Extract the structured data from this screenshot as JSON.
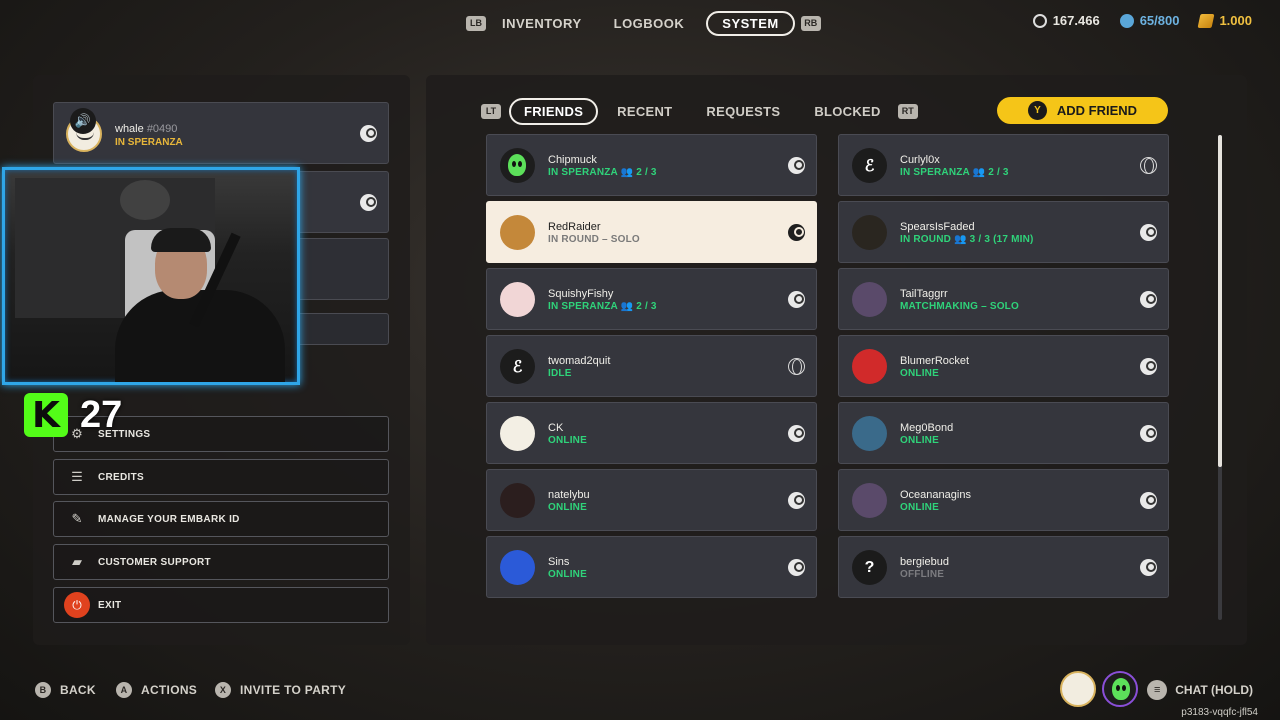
{
  "top_nav": {
    "left_bumper": "LB",
    "right_bumper": "RB",
    "tabs": [
      "INVENTORY",
      "LOGBOOK",
      "SYSTEM"
    ],
    "active_tab": "SYSTEM"
  },
  "currency": {
    "credits": "167.466",
    "storage": "65/800",
    "multibucks": "1.000"
  },
  "party": {
    "member_1": {
      "name": "whale",
      "tag": "#0490",
      "status": "IN SPERANZA"
    }
  },
  "menu": {
    "settings": "SETTINGS",
    "credits": "CREDITS",
    "manage_embark_id": "MANAGE YOUR EMBARK ID",
    "customer_support": "CUSTOMER SUPPORT",
    "exit": "EXIT"
  },
  "stream_overlay": {
    "platform_logo": "K",
    "viewer_count": "27"
  },
  "friends": {
    "left_trigger": "LT",
    "right_trigger": "RT",
    "tabs": [
      "FRIENDS",
      "RECENT",
      "REQUESTS",
      "BLOCKED"
    ],
    "active_tab": "FRIENDS",
    "add_friend_button": "ADD FRIEND",
    "add_friend_key": "Y",
    "list": [
      {
        "name": "Chipmuck",
        "status": "IN SPERANZA",
        "extra": "2 / 3",
        "platform": "steam",
        "avatar": "alien"
      },
      {
        "name": "Curlyl0x",
        "status": "IN SPERANZA",
        "extra": "2 / 3",
        "platform": "web",
        "avatar": "embark"
      },
      {
        "name": "RedRaider",
        "status": "IN ROUND – SOLO",
        "extra": "",
        "platform": "steam",
        "avatar": "photo"
      },
      {
        "name": "SpearsIsFaded",
        "status": "IN ROUND",
        "extra": "3 / 3 (17 MIN)",
        "platform": "steam",
        "avatar": "text"
      },
      {
        "name": "SquishyFishy",
        "status": "IN SPERANZA",
        "extra": "2 / 3",
        "platform": "steam",
        "avatar": "cartoon"
      },
      {
        "name": "TailTaggrr",
        "status": "MATCHMAKING – SOLO",
        "extra": "",
        "platform": "steam",
        "avatar": "art"
      },
      {
        "name": "twomad2quit",
        "status": "IDLE",
        "extra": "",
        "platform": "web",
        "avatar": "embark"
      },
      {
        "name": "BlumerRocket",
        "status": "ONLINE",
        "extra": "",
        "platform": "steam",
        "avatar": "red"
      },
      {
        "name": "CK",
        "status": "ONLINE",
        "extra": "",
        "platform": "steam",
        "avatar": "face"
      },
      {
        "name": "Meg0Bond",
        "status": "ONLINE",
        "extra": "",
        "platform": "steam",
        "avatar": "eye"
      },
      {
        "name": "natelybu",
        "status": "ONLINE",
        "extra": "",
        "platform": "steam",
        "avatar": "dark"
      },
      {
        "name": "Oceananagins",
        "status": "ONLINE",
        "extra": "",
        "platform": "steam",
        "avatar": "art"
      },
      {
        "name": "Sins",
        "status": "ONLINE",
        "extra": "",
        "platform": "steam",
        "avatar": "sonic"
      },
      {
        "name": "bergiebud",
        "status": "OFFLINE",
        "extra": "",
        "platform": "steam",
        "avatar": "question"
      }
    ]
  },
  "bottom_hints": {
    "back_key": "B",
    "back": "BACK",
    "actions_key": "A",
    "actions": "ACTIONS",
    "invite_key": "X",
    "invite": "INVITE TO PARTY",
    "chat": "CHAT (HOLD)"
  },
  "session_id": "p3183-vqqfc-jfl54",
  "colors": {
    "accent_yellow": "#f5c518",
    "online_green": "#2fd37a",
    "party_gold": "#e8b73a",
    "exit_red": "#e0421e",
    "webcam_border": "#2fa6e8"
  }
}
